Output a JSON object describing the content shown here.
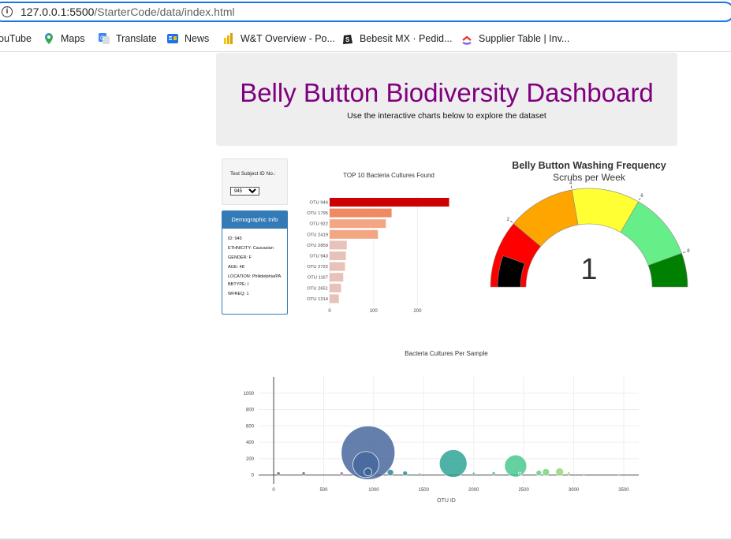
{
  "browser": {
    "url_host": "127.0.0.1:5500",
    "url_path": "/StarterCode/data/index.html",
    "bookmarks": [
      {
        "label": "ouTube",
        "icon": "youtube-icon",
        "color": "#ff0000"
      },
      {
        "label": "Maps",
        "icon": "maps-icon",
        "color": "#34a853"
      },
      {
        "label": "Translate",
        "icon": "translate-icon",
        "color": "#4285f4"
      },
      {
        "label": "News",
        "icon": "news-icon",
        "color": "#1a73e8"
      },
      {
        "label": "W&T Overview - Po...",
        "icon": "powerbi-icon",
        "color": "#f2c811"
      },
      {
        "label": "Bebesit MX · Pedid...",
        "icon": "shopify-icon",
        "color": "#222222"
      },
      {
        "label": "Supplier Table | Inv...",
        "icon": "clickup-icon",
        "color": "#e53935"
      }
    ]
  },
  "header": {
    "title": "Belly Button Biodiversity Dashboard",
    "subtitle": "Use the interactive charts below to explore the dataset"
  },
  "selector": {
    "label": "Test Subject ID No.:",
    "selected": "945"
  },
  "demographics": {
    "heading": "Demographic Info",
    "rows": [
      "ID: 945",
      "ETHNICITY: Caucasian",
      "GENDER: F",
      "AGE: 48",
      "LOCATION: Philidelphia/PA",
      "BBTYPE: I",
      "WFREQ: 1"
    ]
  },
  "chart_data": [
    {
      "type": "bar",
      "orientation": "horizontal",
      "title": "TOP 10 Bacteria Cultures Found",
      "categories": [
        "OTU 944",
        "OTU 1795",
        "OTU 922",
        "OTU 2419",
        "OTU 2859",
        "OTU 943",
        "OTU 2722",
        "OTU 1167",
        "OTU 2651",
        "OTU 1314"
      ],
      "values": [
        272,
        141,
        128,
        110,
        39,
        37,
        35,
        31,
        26,
        21
      ],
      "colors": [
        "#cc0000",
        "#ef8a62",
        "#f4a582",
        "#f4a582",
        "#e6c2b8",
        "#e6c2b8",
        "#e6c2b8",
        "#e6c2b8",
        "#e6c2b8",
        "#e6c2b8"
      ],
      "xticks": [
        0,
        100,
        200
      ],
      "xlim": [
        0,
        280
      ]
    },
    {
      "type": "gauge",
      "title": "Belly Button Washing Frequency",
      "subtitle": "Scrubs per Week",
      "value": 1,
      "range": [
        0,
        9
      ],
      "ticks": [
        2,
        4,
        6,
        8
      ],
      "steps": [
        {
          "range": [
            0,
            2
          ],
          "color": "#ff0000"
        },
        {
          "range": [
            2,
            4
          ],
          "color": "#ffa500"
        },
        {
          "range": [
            4,
            6
          ],
          "color": "#ffff33"
        },
        {
          "range": [
            6,
            8
          ],
          "color": "#66ee88"
        },
        {
          "range": [
            8,
            9
          ],
          "color": "#008000"
        }
      ],
      "bar_color": "#000000"
    },
    {
      "type": "scatter",
      "subtype": "bubble",
      "title": "Bacteria Cultures Per Sample",
      "xlabel": "OTU ID",
      "xticks": [
        0,
        500,
        1000,
        1500,
        2000,
        2500,
        3000,
        3500
      ],
      "yticks": [
        0,
        200,
        400,
        600,
        800,
        1000
      ],
      "xlim": [
        -150,
        3650
      ],
      "ylim": [
        -110,
        1200
      ],
      "points": [
        {
          "x": 48,
          "y": 20,
          "size": 8,
          "color": "#7b3f8c"
        },
        {
          "x": 300,
          "y": 20,
          "size": 8,
          "color": "#7b3f8c"
        },
        {
          "x": 680,
          "y": 20,
          "size": 8,
          "color": "#8e6aa8"
        },
        {
          "x": 944,
          "y": 272,
          "size": 136,
          "color": "#3f5f97"
        },
        {
          "x": 922,
          "y": 128,
          "size": 66,
          "color": "#43679c"
        },
        {
          "x": 943,
          "y": 37,
          "size": 20,
          "color": "#3a6496"
        },
        {
          "x": 1167,
          "y": 31,
          "size": 16,
          "color": "#1f7d94"
        },
        {
          "x": 1314,
          "y": 21,
          "size": 12,
          "color": "#23868f"
        },
        {
          "x": 1795,
          "y": 141,
          "size": 70,
          "color": "#22a090"
        },
        {
          "x": 2419,
          "y": 110,
          "size": 56,
          "color": "#3ec58a"
        },
        {
          "x": 2651,
          "y": 26,
          "size": 14,
          "color": "#5fd07a"
        },
        {
          "x": 2722,
          "y": 35,
          "size": 18,
          "color": "#6cd470"
        },
        {
          "x": 2859,
          "y": 39,
          "size": 20,
          "color": "#8ad868"
        },
        {
          "x": 2950,
          "y": 20,
          "size": 8,
          "color": "#a8dc5c"
        },
        {
          "x": 2200,
          "y": 20,
          "size": 8,
          "color": "#31b88b"
        },
        {
          "x": 2460,
          "y": 20,
          "size": 6,
          "color": "#49c688"
        },
        {
          "x": 2000,
          "y": 20,
          "size": 6,
          "color": "#27aa8d"
        },
        {
          "x": 1460,
          "y": 20,
          "size": 4,
          "color": "#228c8d"
        },
        {
          "x": 3100,
          "y": 12,
          "size": 4,
          "color": "#c8e05a"
        },
        {
          "x": 3450,
          "y": 12,
          "size": 4,
          "color": "#e6e450"
        }
      ]
    }
  ]
}
